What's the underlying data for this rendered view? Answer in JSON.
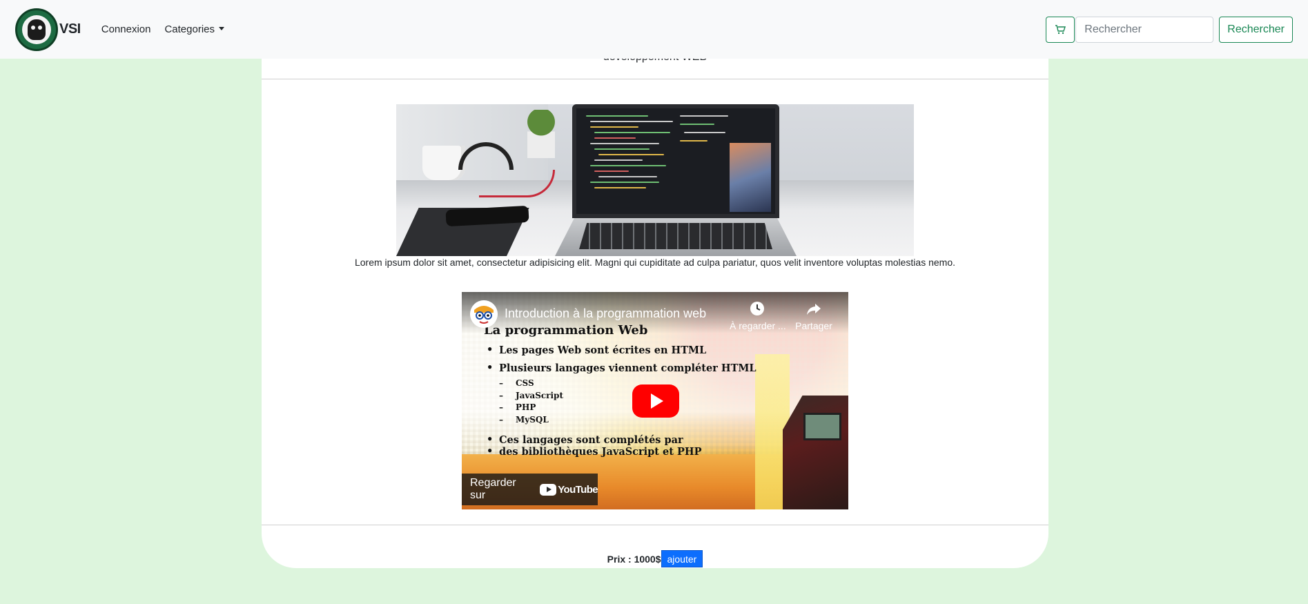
{
  "navbar": {
    "brand_name": "VSI",
    "links": [
      {
        "label": "Connexion"
      },
      {
        "label": "Categories"
      }
    ],
    "search": {
      "placeholder": "Rechercher",
      "value": "",
      "button_label": "Rechercher"
    },
    "icons": {
      "cart": "cart-icon",
      "logo": "logo-icon"
    }
  },
  "card": {
    "header_text": "développement WEB",
    "caption": "Lorem ipsum dolor sit amet, consectetur adipisicing elit. Magni qui cupiditate ad culpa pariatur, quos velit inventore voluptas molestias nemo.",
    "video": {
      "title": "Introduction à la programmation web",
      "actions": [
        {
          "label": "À regarder ...",
          "icon": "clock-icon"
        },
        {
          "label": "Partager",
          "icon": "share-icon"
        }
      ],
      "slide": {
        "heading": "La programmation Web",
        "bullet_1": "Les pages Web sont écrites en HTML",
        "bullet_2": "Plusieurs langages viennent compléter HTML",
        "sub_items": [
          "CSS",
          "JavaScript",
          "PHP",
          "MySQL"
        ],
        "bullet_3_line1": "Ces langages sont complétés par",
        "bullet_3_line2": "des bibliothèques JavaScript et PHP"
      },
      "watch_on_label": "Regarder sur",
      "youtube_label": "YouTube"
    },
    "price_label": "Prix : 1000$",
    "add_button_label": "ajouter"
  },
  "colors": {
    "page_background": "#ddf5dd",
    "navbar_background": "#f8f9fa",
    "success_green": "#198754",
    "primary_blue": "#0d6efd",
    "youtube_red": "#ff0000"
  }
}
